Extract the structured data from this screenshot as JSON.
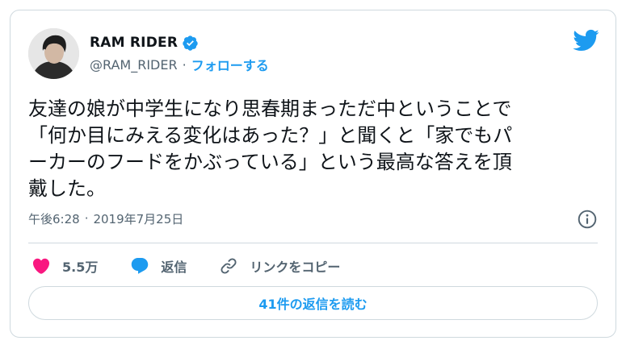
{
  "user": {
    "display_name": "RAM RIDER",
    "handle": "@RAM_RIDER",
    "separator": "·",
    "follow_label": "フォローする"
  },
  "tweet": {
    "text": "友達の娘が中学生になり思春期まっただ中ということで\n「何か目にみえる変化はあった？」と聞くと「家でもパ\nーカーのフードをかぶっている」という最高な答えを頂\n戴した。",
    "time": "午後6:28",
    "separator": "·",
    "date": "2019年7月25日"
  },
  "actions": {
    "like_count": "5.5万",
    "reply_label": "返信",
    "copy_link_label": "リンクをコピー"
  },
  "footer": {
    "read_replies_label": "41件の返信を読む"
  },
  "colors": {
    "accent": "#1d9bf0",
    "like": "#f91880",
    "text": "#0f1419",
    "secondary": "#536471",
    "border": "#cfd9de"
  },
  "icons": {
    "brand": "twitter-bird-icon",
    "verified": "verified-badge-icon",
    "info": "info-icon",
    "like": "heart-icon",
    "reply": "speech-bubble-icon",
    "link": "link-icon"
  }
}
